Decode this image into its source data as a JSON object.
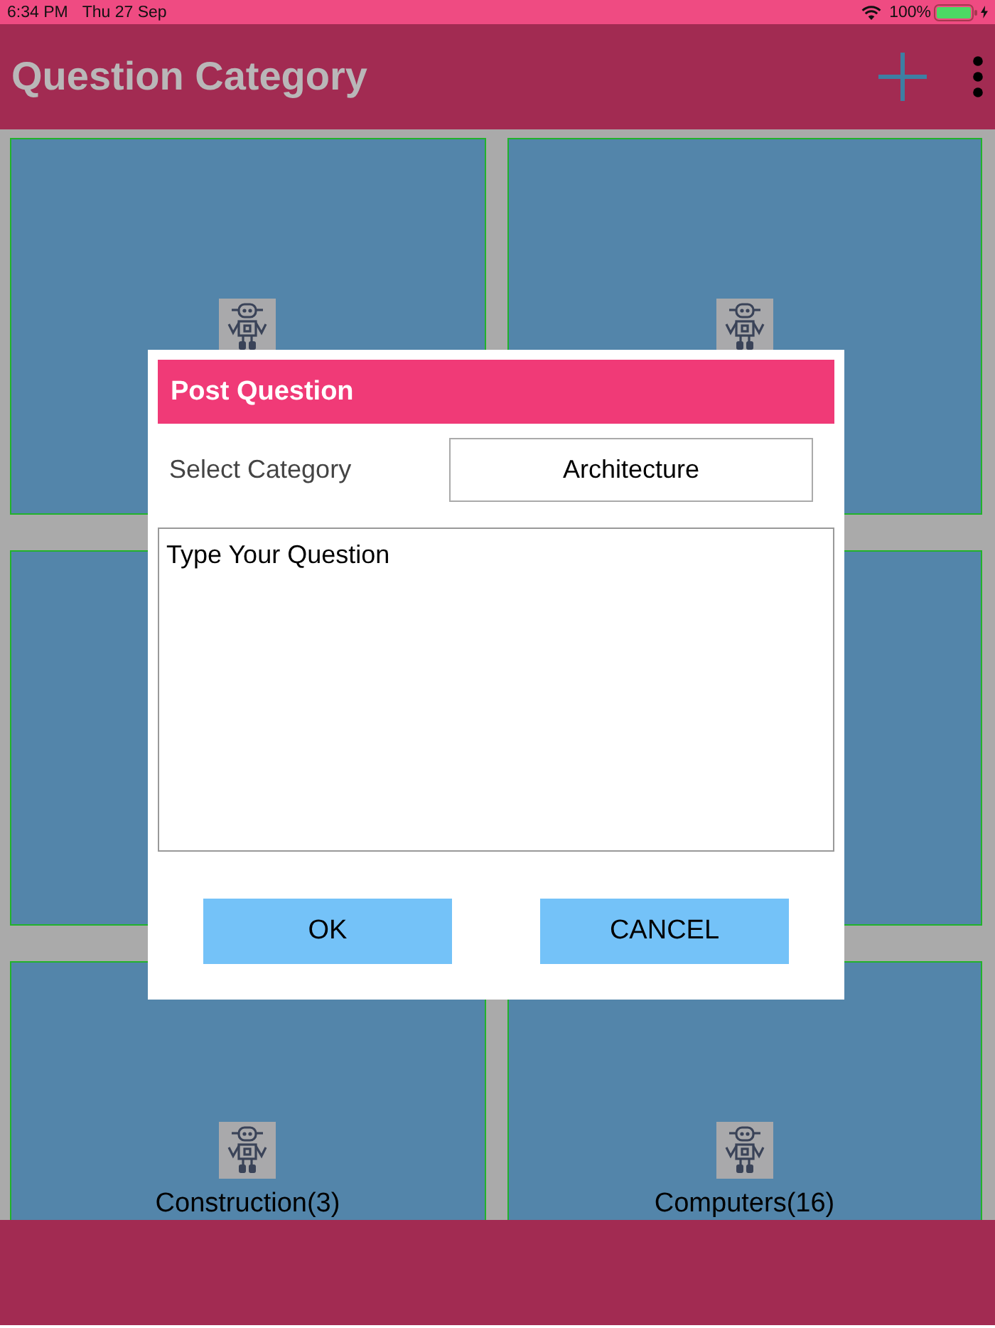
{
  "status_bar": {
    "time": "6:34 PM",
    "date": "Thu 27 Sep",
    "battery": "100%"
  },
  "app_bar": {
    "title": "Question Category"
  },
  "tiles": [
    {
      "kind": "icon"
    },
    {
      "kind": "icon"
    },
    {
      "kind": "blank"
    },
    {
      "kind": "blank"
    },
    {
      "kind": "labelled",
      "label": "Construction(3)"
    },
    {
      "kind": "labelled",
      "label": "Computers(16)"
    }
  ],
  "dialog": {
    "title": "Post Question",
    "category_label": "Select Category",
    "category_value": "Architecture",
    "question": {
      "placeholder": "Type Your Question"
    },
    "buttons": [
      "OK",
      "CANCEL"
    ]
  }
}
